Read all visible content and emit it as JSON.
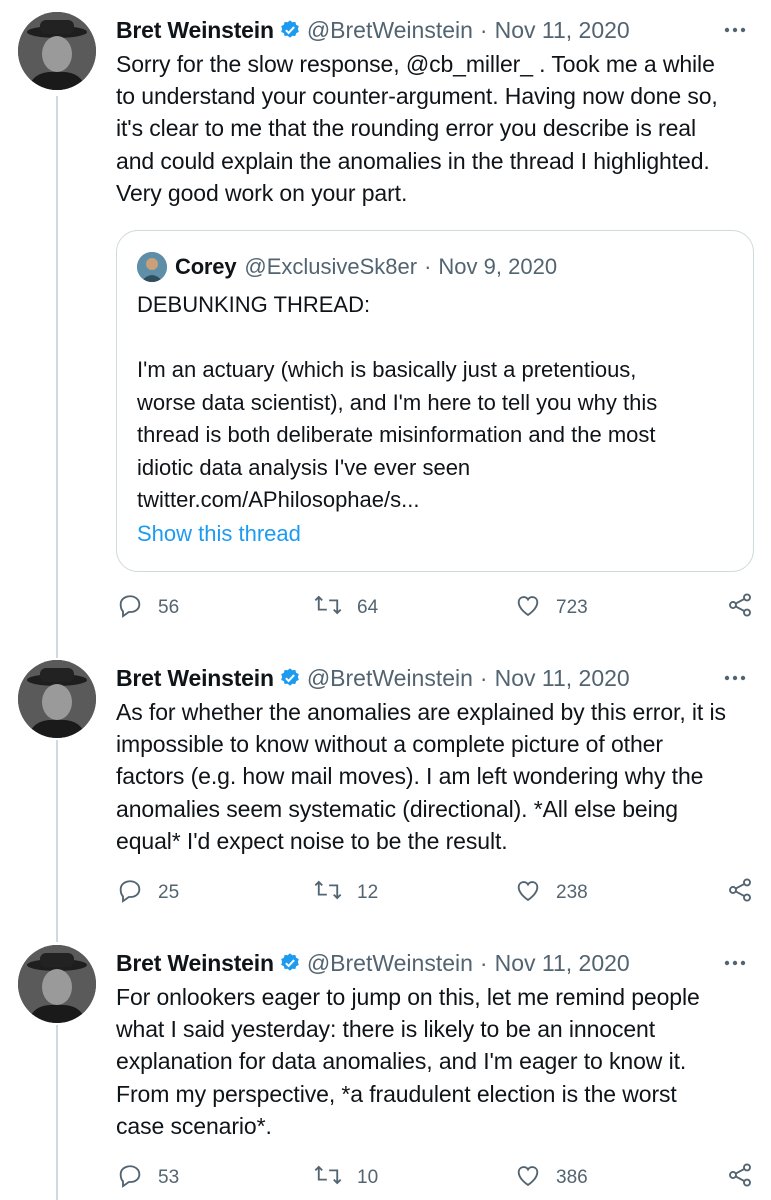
{
  "tweets": [
    {
      "author": "Bret Weinstein",
      "handle": "@BretWeinstein",
      "date": "Nov 11, 2020",
      "text": "Sorry for the slow response, @cb_miller_ . Took me a while\nto understand your counter-argument. Having now done so,\nit's clear to me that the rounding error you describe is real\nand could explain the anomalies in the thread I highlighted.\nVery good work on your part.",
      "quote": {
        "author": "Corey",
        "handle": "@ExclusiveSk8er",
        "date": "Nov 9, 2020",
        "text": "DEBUNKING THREAD:\n\nI'm an actuary (which is basically just a pretentious,\nworse data scientist), and I'm here to tell you why this\nthread is both deliberate misinformation and the most\nidiotic data analysis I've ever seen\ntwitter.com/APhilosophae/s...",
        "link": "Show this thread"
      },
      "replies": "56",
      "retweets": "64",
      "likes": "723"
    },
    {
      "author": "Bret Weinstein",
      "handle": "@BretWeinstein",
      "date": "Nov 11, 2020",
      "text": "As for whether the anomalies are explained by this error, it is\nimpossible to know without a complete picture of other\nfactors (e.g. how mail moves). I am left wondering why the\nanomalies seem systematic (directional). *All else being\nequal* I'd expect noise to be the result.",
      "replies": "25",
      "retweets": "12",
      "likes": "238"
    },
    {
      "author": "Bret Weinstein",
      "handle": "@BretWeinstein",
      "date": "Nov 11, 2020",
      "text": "For onlookers eager to jump on this, let me remind people\nwhat I said yesterday: there is likely to be an innocent\nexplanation for data anomalies, and I'm eager to know it.\nFrom my perspective, *a fraudulent election is the worst\ncase scenario*.",
      "replies": "53",
      "retweets": "10",
      "likes": "386"
    }
  ],
  "separator": "·",
  "colors": {
    "accent": "#1d9bf0",
    "secondary_text": "#536471",
    "border": "#cfd9de"
  },
  "icons": [
    "verified-badge-icon",
    "more-icon",
    "reply-icon",
    "retweet-icon",
    "like-icon",
    "share-icon"
  ]
}
